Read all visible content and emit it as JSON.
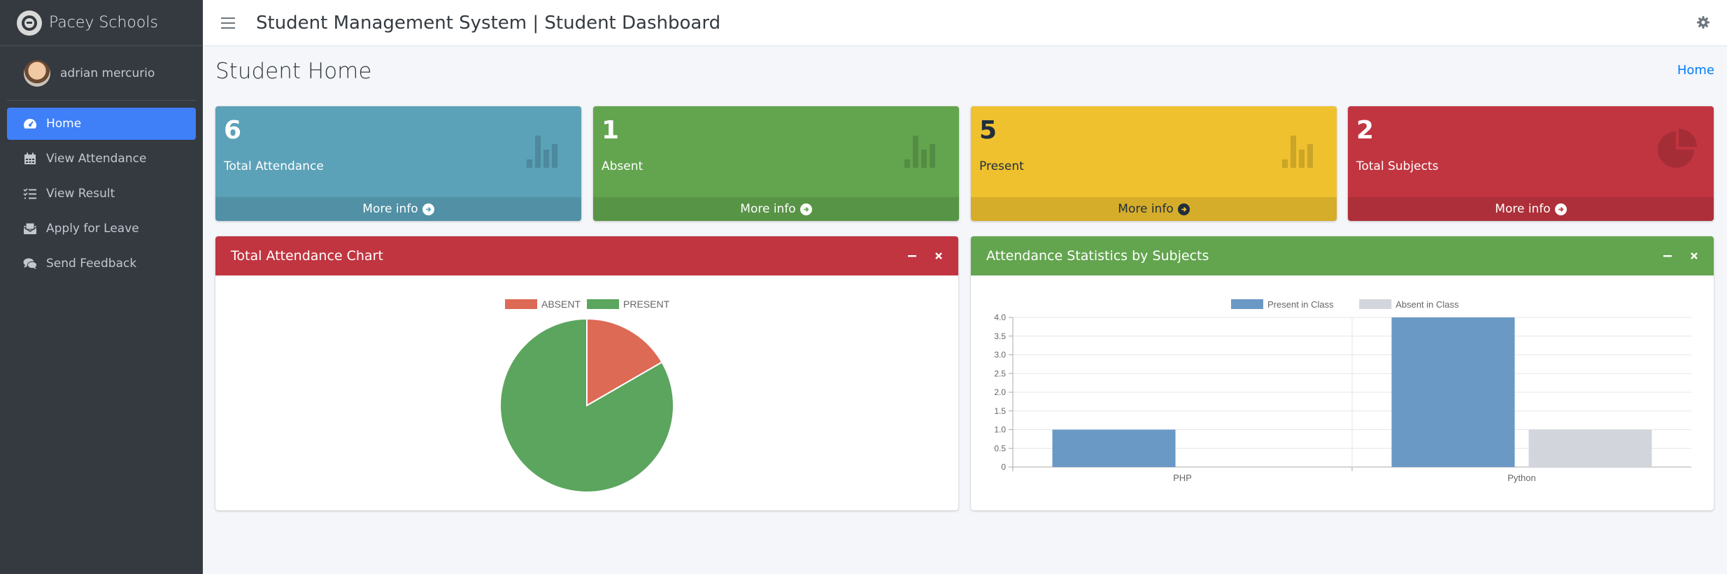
{
  "brand": {
    "name": "Pacey Schools"
  },
  "user": {
    "name": "adrian mercurio"
  },
  "sidebar": {
    "items": [
      {
        "label": "Home",
        "icon": "tachometer-icon",
        "active": true
      },
      {
        "label": "View Attendance",
        "icon": "calendar-icon",
        "active": false
      },
      {
        "label": "View Result",
        "icon": "list-check-icon",
        "active": false
      },
      {
        "label": "Apply for Leave",
        "icon": "envelope-open-icon",
        "active": false
      },
      {
        "label": "Send Feedback",
        "icon": "comments-icon",
        "active": false
      }
    ]
  },
  "header": {
    "title": "Student Management System | Student Dashboard",
    "settings_icon": "gear-icon"
  },
  "page": {
    "title": "Student Home",
    "breadcrumb": "Home"
  },
  "stats": [
    {
      "value": "6",
      "label": "Total Attendance",
      "footer": "More info",
      "color": "#5ba1b8",
      "icon": "bar-chart-icon"
    },
    {
      "value": "1",
      "label": "Absent",
      "footer": "More info",
      "color": "#63a54f",
      "icon": "bar-chart-icon"
    },
    {
      "value": "5",
      "label": "Present",
      "footer": "More info",
      "color": "#efc12f",
      "icon": "bar-chart-icon"
    },
    {
      "value": "2",
      "label": "Total Subjects",
      "footer": "More info",
      "color": "#c13540",
      "icon": "pie-chart-icon"
    }
  ],
  "cards": {
    "attendance_chart": {
      "title": "Total Attendance Chart",
      "color": "#c13540"
    },
    "subject_stats": {
      "title": "Attendance Statistics by Subjects",
      "color": "#63a54f"
    }
  },
  "chart_data": [
    {
      "type": "pie",
      "title": "",
      "labels": [
        "ABSENT",
        "PRESENT"
      ],
      "values": [
        1,
        5
      ],
      "colors": [
        "#dd6a55",
        "#5ba55e"
      ],
      "legend": "top"
    },
    {
      "type": "bar",
      "title": "",
      "categories": [
        "PHP",
        "Python"
      ],
      "series": [
        {
          "name": "Present in Class",
          "values": [
            1,
            4
          ],
          "color": "#6a99c5"
        },
        {
          "name": "Absent in Class",
          "values": [
            0,
            1
          ],
          "color": "#d2d5dc"
        }
      ],
      "ylim": [
        0,
        4
      ],
      "yticks": [
        "0",
        "0.5",
        "1.0",
        "1.5",
        "2.0",
        "2.5",
        "3.0",
        "3.5",
        "4.0"
      ],
      "grid": true,
      "legend": "top"
    }
  ]
}
